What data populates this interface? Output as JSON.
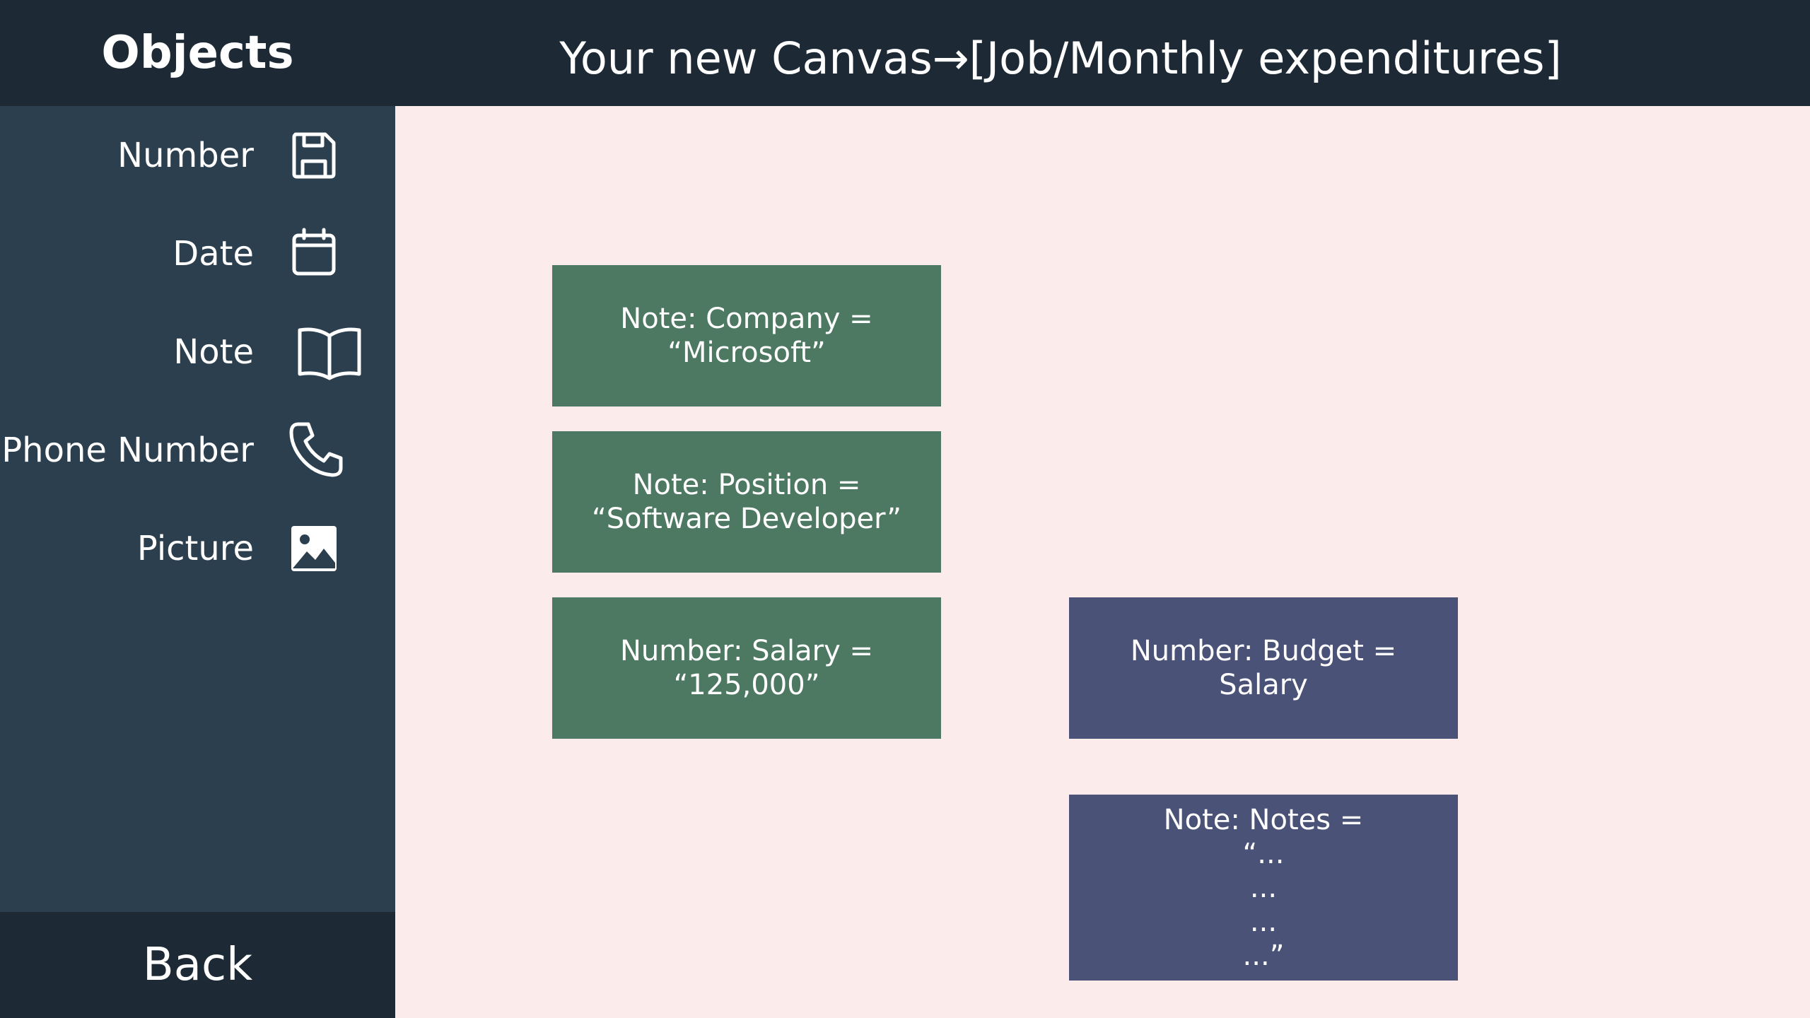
{
  "app": {
    "sidebar_title": "Objects",
    "canvas_title": "Your new Canvas→[Job/Monthly expenditures]"
  },
  "sidebar": {
    "items": [
      {
        "label": "Number",
        "icon": "floppy-disk-icon"
      },
      {
        "label": "Date",
        "icon": "calendar-icon"
      },
      {
        "label": "Note",
        "icon": "book-icon"
      },
      {
        "label": "Phone Number",
        "icon": "phone-icon"
      },
      {
        "label": "Picture",
        "icon": "image-icon"
      }
    ],
    "back_label": "Back"
  },
  "canvas": {
    "cards": [
      {
        "text": "Note: Company =\n“Microsoft”",
        "color": "#4d7962"
      },
      {
        "text": "Note: Position =\n“Software Developer”",
        "color": "#4d7962"
      },
      {
        "text": "Number: Salary =\n“125,000”",
        "color": "#4d7962"
      },
      {
        "text": "Number: Budget =\nSalary",
        "color": "#4b5277"
      },
      {
        "text": "Note: Notes =\n“...\n...\n...\n...”",
        "color": "#4b5277"
      }
    ]
  },
  "colors": {
    "topbar": "#1d2a35",
    "sidebar": "#2c3f4e",
    "canvas": "#fbeceb",
    "green_card": "#4d7962",
    "purple_card": "#4b5277"
  }
}
